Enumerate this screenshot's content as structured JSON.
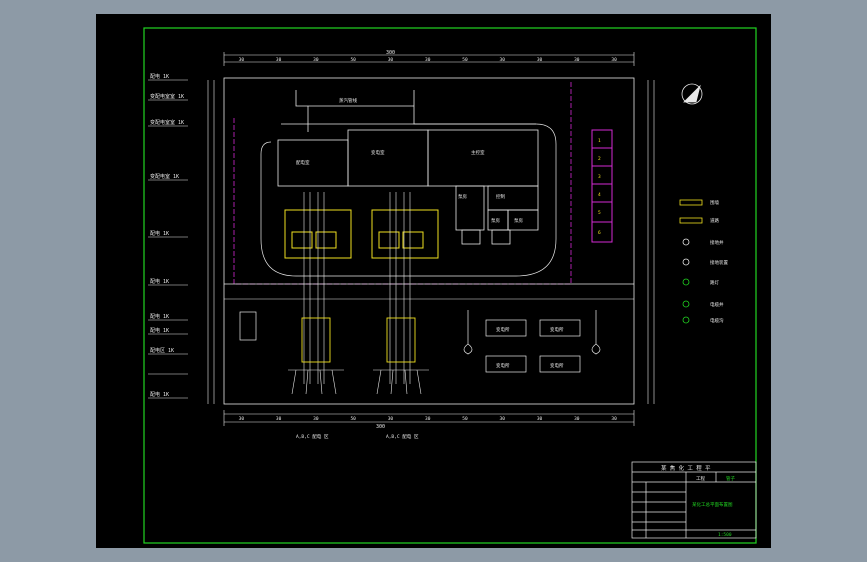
{
  "drawing": {
    "title_block": {
      "header": "某 焦 化 工 程 平",
      "col_a": "工程",
      "col_b": "管子",
      "drawing_name": "某化工总平面布置图",
      "bottom_right": "1:500"
    },
    "dims_top": {
      "overall": "300",
      "segments": [
        "30",
        "30",
        "30",
        "50",
        "30",
        "30",
        "50",
        "30",
        "30",
        "30",
        "30"
      ]
    },
    "dims_bottom": {
      "segments": [
        "30",
        "30",
        "30",
        "50",
        "30",
        "30",
        "50",
        "30",
        "30",
        "30",
        "30"
      ],
      "overall": "300",
      "left_label": "A,B,C 配电 区",
      "right_label": "A,B,C 配电 区"
    },
    "left_labels": [
      "配电 1K",
      "变配电室室 1K",
      "变配电室室 1K",
      "变配电室 1K",
      "配电 1K",
      "配电 1K",
      "配电 1K",
      "配电 1K",
      "配电区 1K",
      "配电 1K"
    ],
    "rooms": {
      "r1": "配电室",
      "r2": "变电室",
      "r3": "主控室",
      "r4": "泵房",
      "r5": "控制",
      "r6": "泵房",
      "r7": "泵房",
      "t1": "变电所",
      "t2": "变电所",
      "t3": "变电所",
      "t4": "变电所",
      "pipe_label": "蒸汽管线"
    },
    "magenta_labels": [
      "1",
      "2",
      "3",
      "4",
      "5",
      "6"
    ],
    "legend": [
      {
        "label": "围墙"
      },
      {
        "label": "道路"
      },
      {
        "label": "接地井"
      },
      {
        "label": "接地装置"
      },
      {
        "label": "路灯"
      },
      {
        "label": "电缆井"
      },
      {
        "label": "电缆沟"
      }
    ]
  }
}
